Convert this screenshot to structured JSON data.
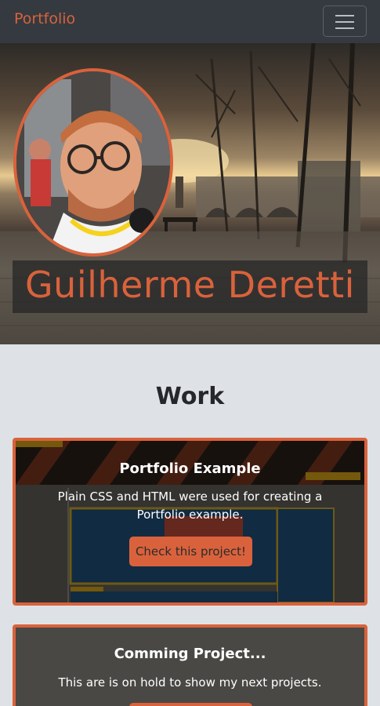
{
  "navbar": {
    "brand": "Portfolio",
    "toggle_icon": "hamburger-menu-icon"
  },
  "hero": {
    "name": "Guilherme Deretti"
  },
  "work": {
    "heading": "Work",
    "projects": [
      {
        "title": "Portfolio Example",
        "description": "Plain CSS and HTML were used for creating a Portfolio example.",
        "button_label": "Check this project!"
      },
      {
        "title": "Comming Project...",
        "description": "This are is on hold to show my next projects.",
        "button_label": ""
      }
    ]
  },
  "colors": {
    "accent": "#d9623c",
    "navbar_bg": "#343a40",
    "page_bg": "#dee2e6"
  }
}
